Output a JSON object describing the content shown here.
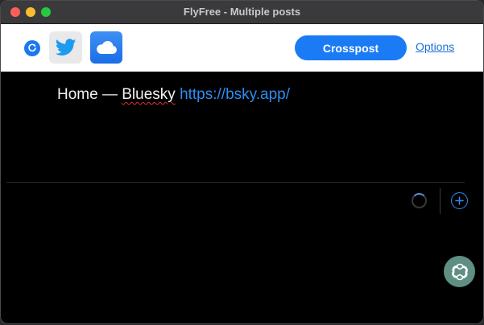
{
  "window": {
    "title": "FlyFree - Multiple posts"
  },
  "toolbar": {
    "refresh_icon": "refresh-icon",
    "twitter_icon": "twitter-bird-icon",
    "bluesky_icon": "cloud-icon",
    "crosspost_label": "Crosspost",
    "options_label": "Options"
  },
  "post": {
    "prefix": "Home — ",
    "bluesky_word": "Bluesky",
    "link": "https://bsky.app/"
  },
  "footer": {
    "spinner_icon": "loading-spinner-icon",
    "add_icon": "plus-circle-icon",
    "assistant_icon": "chatgpt-icon"
  },
  "colors": {
    "accent": "#1a7bf5",
    "link": "#2f8cf0",
    "assistant": "#5e8f82"
  }
}
